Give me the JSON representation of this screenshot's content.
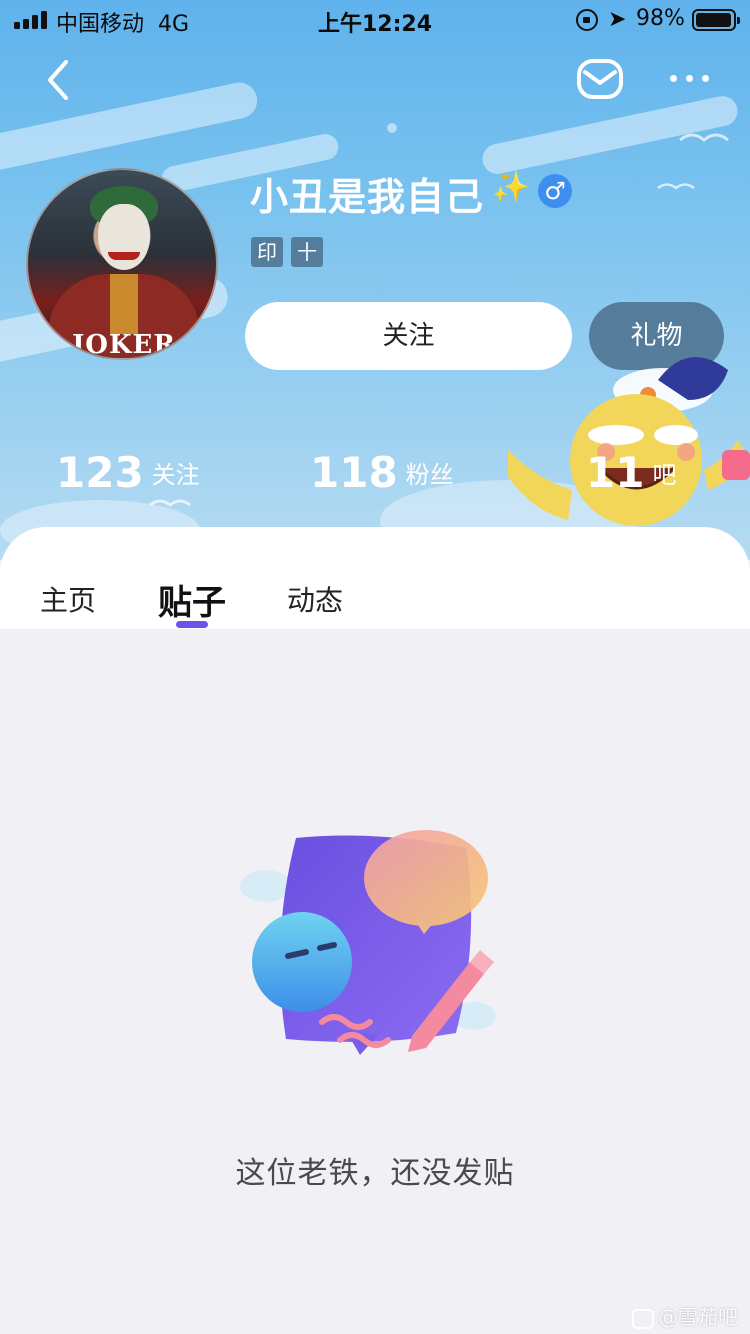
{
  "status_bar": {
    "carrier": "中国移动",
    "network": "4G",
    "time": "上午12:24",
    "battery_percent": "98%",
    "battery_level": 0.98
  },
  "nav": {
    "back_icon": "chevron-left-icon",
    "mail_icon": "mail-icon",
    "more_icon": "more-dots-icon"
  },
  "profile": {
    "username": "小丑是我自己",
    "sparkle": "✨",
    "gender_symbol": "♂",
    "avatar_text": "JOKER",
    "tags": [
      "印",
      "十"
    ],
    "follow_label": "关注",
    "gift_label": "礼物"
  },
  "stats": [
    {
      "value": "123",
      "label": "关注"
    },
    {
      "value": "118",
      "label": "粉丝"
    },
    {
      "value": "11",
      "label": "吧"
    }
  ],
  "tabs": {
    "items": [
      "主页",
      "贴子",
      "动态"
    ],
    "active": "贴子"
  },
  "empty_state": {
    "message": "这位老铁，还没发贴"
  },
  "watermark": "@雪茄吧",
  "colors": {
    "header_top": "#5fb2ec",
    "accent": "#6b55e8",
    "page_bg": "#f1f0f5",
    "gender_badge": "#3e8ef0"
  }
}
